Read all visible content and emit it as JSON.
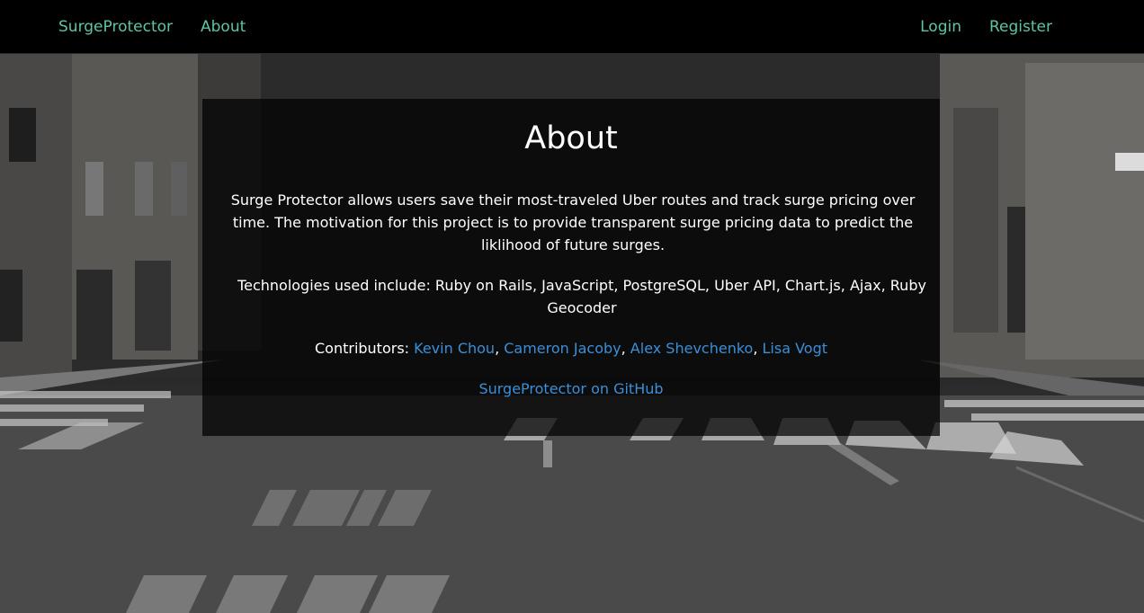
{
  "nav": {
    "brand": "SurgeProtector",
    "about": "About",
    "login": "Login",
    "register": "Register"
  },
  "about": {
    "title": "About",
    "description": "Surge Protector allows users save their most-traveled Uber routes and track surge pricing over time. The motivation for this project is to provide transparent surge pricing data to predict the liklihood of future surges.",
    "technologies": "Technologies used include: Ruby on Rails, JavaScript, PostgreSQL, Uber API, Chart.js, Ajax, Ruby Geocoder",
    "contributors_label": "Contributors: ",
    "contributors": [
      "Kevin Chou",
      "Cameron Jacoby",
      "Alex Shevchenko",
      "Lisa Vogt"
    ],
    "separator": ", ",
    "github_link": "SurgeProtector on GitHub"
  },
  "colors": {
    "nav_link": "#5fc4a3",
    "content_link": "#3b8fd9",
    "navbar_bg": "#000000"
  }
}
